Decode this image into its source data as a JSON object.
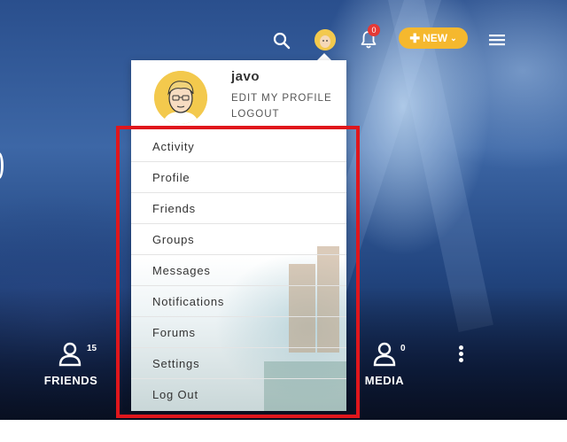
{
  "header": {
    "search_icon": "search-icon",
    "avatar_icon": "user-avatar",
    "notifications_icon": "bell-icon",
    "notifications_count": "0",
    "new_button_label": "NEW",
    "new_button_icon": "plus-icon",
    "menu_icon": "hamburger-icon"
  },
  "dropdown": {
    "username": "javo",
    "edit_profile_label": "EDIT MY PROFILE",
    "logout_label": "LOGOUT",
    "items": [
      {
        "label": "Activity"
      },
      {
        "label": "Profile"
      },
      {
        "label": "Friends"
      },
      {
        "label": "Groups"
      },
      {
        "label": "Messages"
      },
      {
        "label": "Notifications"
      },
      {
        "label": "Forums"
      },
      {
        "label": "Settings"
      },
      {
        "label": "Log Out"
      }
    ]
  },
  "stats": {
    "friends_label": "FRIENDS",
    "friends_count": "15",
    "media_label": "MEDIA",
    "media_count": "0"
  },
  "colors": {
    "accent": "#f5b82e",
    "badge": "#e53935",
    "highlight": "#e0161c"
  }
}
